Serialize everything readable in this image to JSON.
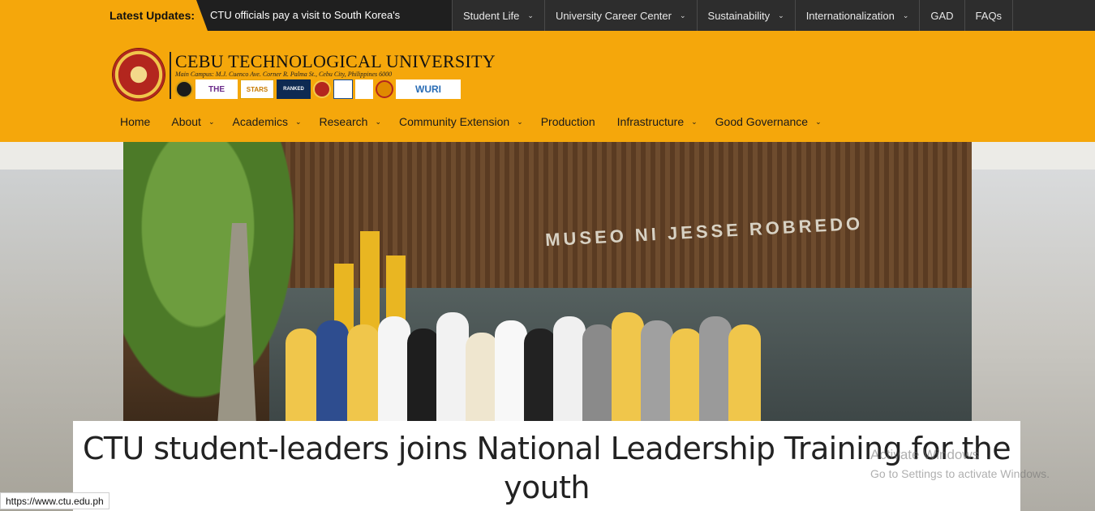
{
  "ticker": {
    "label": "Latest Updates:",
    "headline": "CTU officials pay a visit to South Korea's"
  },
  "top_nav": {
    "items": [
      {
        "label": "Student Life",
        "has_dropdown": true
      },
      {
        "label": "University Career Center",
        "has_dropdown": true
      },
      {
        "label": "Sustainability",
        "has_dropdown": true
      },
      {
        "label": "Internationalization",
        "has_dropdown": true
      },
      {
        "label": "GAD",
        "has_dropdown": false
      },
      {
        "label": "FAQs",
        "has_dropdown": false
      }
    ]
  },
  "header": {
    "university_name": "CEBU TECHNOLOGICAL UNIVERSITY",
    "address": "Main Campus: M.J. Cuenco Ave. Corner R. Palma St., Cebu City, Philippines 6000",
    "badges": {
      "the": "THE",
      "stars": "STARS",
      "ranked": "RANKED",
      "wurl": "WURI"
    }
  },
  "main_nav": {
    "items": [
      {
        "label": "Home",
        "has_dropdown": false
      },
      {
        "label": "About",
        "has_dropdown": true
      },
      {
        "label": "Academics",
        "has_dropdown": true
      },
      {
        "label": "Research",
        "has_dropdown": true
      },
      {
        "label": "Community Extension",
        "has_dropdown": true
      },
      {
        "label": "Production",
        "has_dropdown": false
      },
      {
        "label": "Infrastructure",
        "has_dropdown": true
      },
      {
        "label": "Good Governance",
        "has_dropdown": true
      }
    ]
  },
  "hero": {
    "sign_text": "MUSEO NI JESSE ROBREDO",
    "caption": "CTU student-leaders joins National Leadership Training for the youth"
  },
  "watermark": {
    "line1": "Activate Windows",
    "line2": "Go to Settings to activate Windows."
  },
  "status_bar": {
    "url": "https://www.ctu.edu.ph"
  },
  "colors": {
    "brand_yellow": "#f5a70b",
    "topnav_dark": "#2d2d2d",
    "ticker_dark": "#1f1f1f"
  },
  "icons": {
    "dropdown": "chevron-down-icon",
    "seal": "university-seal-icon"
  }
}
